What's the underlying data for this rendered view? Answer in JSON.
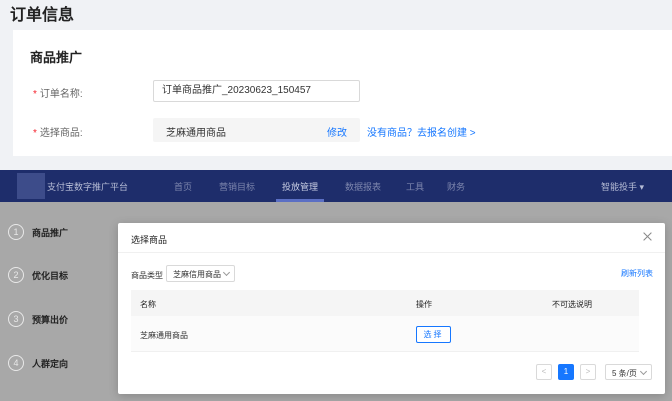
{
  "page": {
    "title": "订单信息",
    "section_title": "商品推广"
  },
  "form": {
    "order_name_label": "订单名称:",
    "order_name_value": "订单商品推广_20230623_150457",
    "product_label": "选择商品:",
    "product_value": "芝麻通用商品",
    "edit_label": "修改",
    "no_product_link": "没有商品？去报名创建 >",
    "required_mark": "*"
  },
  "navbar": {
    "brand": "支付宝数字推广平台",
    "items": [
      "首页",
      "营销目标",
      "投放管理",
      "数据报表",
      "工具",
      "财务"
    ],
    "active_index": 2,
    "assistant": "智能投手 ▾"
  },
  "steps": [
    {
      "num": "1",
      "label": "商品推广"
    },
    {
      "num": "2",
      "label": "优化目标"
    },
    {
      "num": "3",
      "label": "预算出价"
    },
    {
      "num": "4",
      "label": "人群定向"
    }
  ],
  "modal": {
    "title": "选择商品",
    "type_label": "商品类型",
    "type_value": "芝麻信用商品",
    "refresh_label": "刷新列表",
    "columns": [
      "名称",
      "操作",
      "不可选说明"
    ],
    "rows": [
      {
        "name": "芝麻通用商品",
        "action": "选择",
        "note": ""
      }
    ],
    "pagination": {
      "prev": "<",
      "current_page": "1",
      "next": ">",
      "page_size": "5 条/页"
    }
  },
  "colors": {
    "primary": "#1677ff",
    "required": "#f5222d",
    "navbar_bg": "#1e2d6b"
  }
}
